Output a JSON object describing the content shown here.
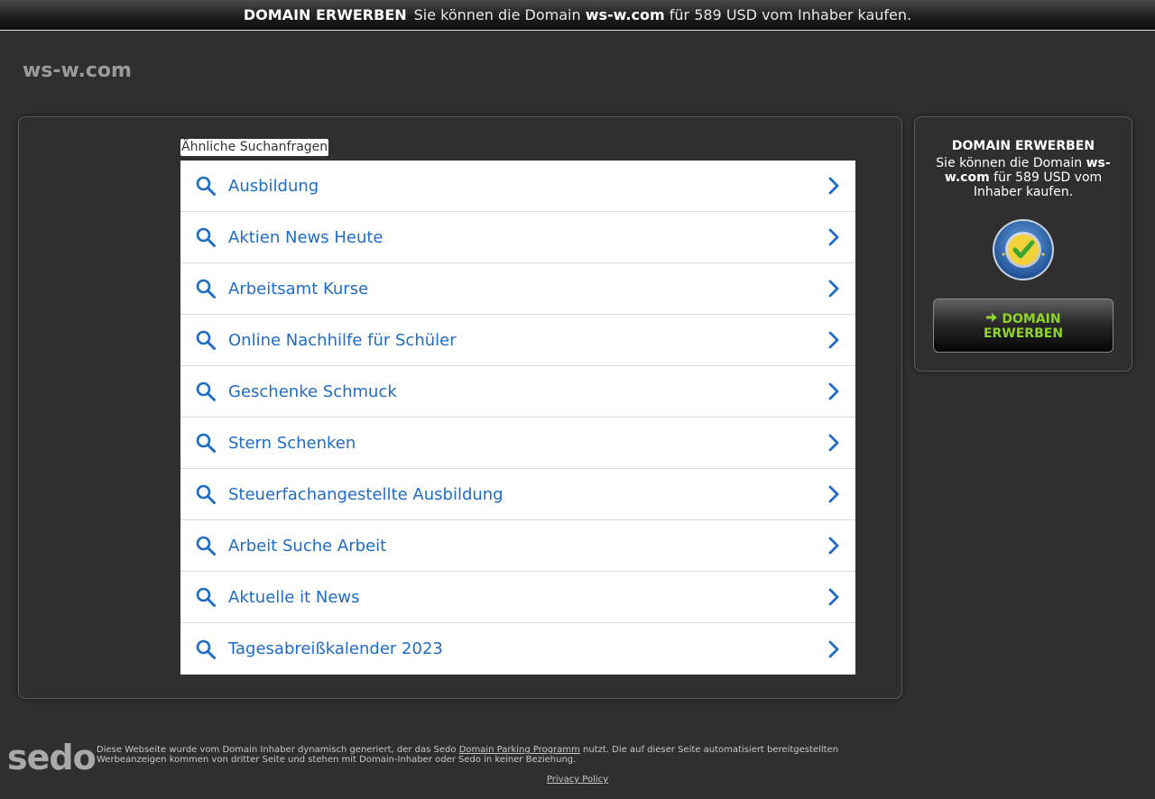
{
  "banner": {
    "heading": "DOMAIN ERWERBEN",
    "text_before": "Sie können die Domain",
    "domain": "ws-w.com",
    "text_after": "für 589 USD vom Inhaber kaufen."
  },
  "site_title": "ws-w.com",
  "related": {
    "label": "Ähnliche Suchanfragen",
    "items": [
      {
        "label": "Ausbildung"
      },
      {
        "label": "Aktien News Heute"
      },
      {
        "label": "Arbeitsamt Kurse"
      },
      {
        "label": "Online Nachhilfe für Schüler"
      },
      {
        "label": "Geschenke Schmuck"
      },
      {
        "label": "Stern Schenken"
      },
      {
        "label": "Steuerfachangestellte Ausbildung"
      },
      {
        "label": "Arbeit Suche Arbeit"
      },
      {
        "label": "Aktuelle it News"
      },
      {
        "label": "Tagesabreißkalender 2023"
      }
    ],
    "item_icon": "search-icon",
    "item_arrow_icon": "chevron-right-icon"
  },
  "sidebar": {
    "title": "DOMAIN ERWERBEN",
    "text_before": "Sie können die Domain",
    "domain": "ws-w.com",
    "text_after": "für 589 USD vom Inhaber kaufen.",
    "badge_icon": "sedo-buyer-protection-badge",
    "button_label_1": "DOMAIN",
    "button_label_2": "ERWERBEN",
    "button_icon": "arrow-right-circle-icon"
  },
  "footer": {
    "logo": "sedo",
    "text_before": "Diese Webseite wurde vom Domain Inhaber dynamisch generiert, der das Sedo",
    "link": "Domain Parking Programm",
    "text_after": "nutzt. Die auf dieser Seite automatisiert bereitgestellten Werbeanzeigen kommen von dritter Seite und stehen mit Domain-Inhaber oder Sedo in keiner Beziehung.",
    "privacy": "Privacy Policy"
  },
  "colors": {
    "background": "#2f2f2f",
    "link_blue": "#1f6cc4",
    "button_green": "#8fd32a"
  }
}
